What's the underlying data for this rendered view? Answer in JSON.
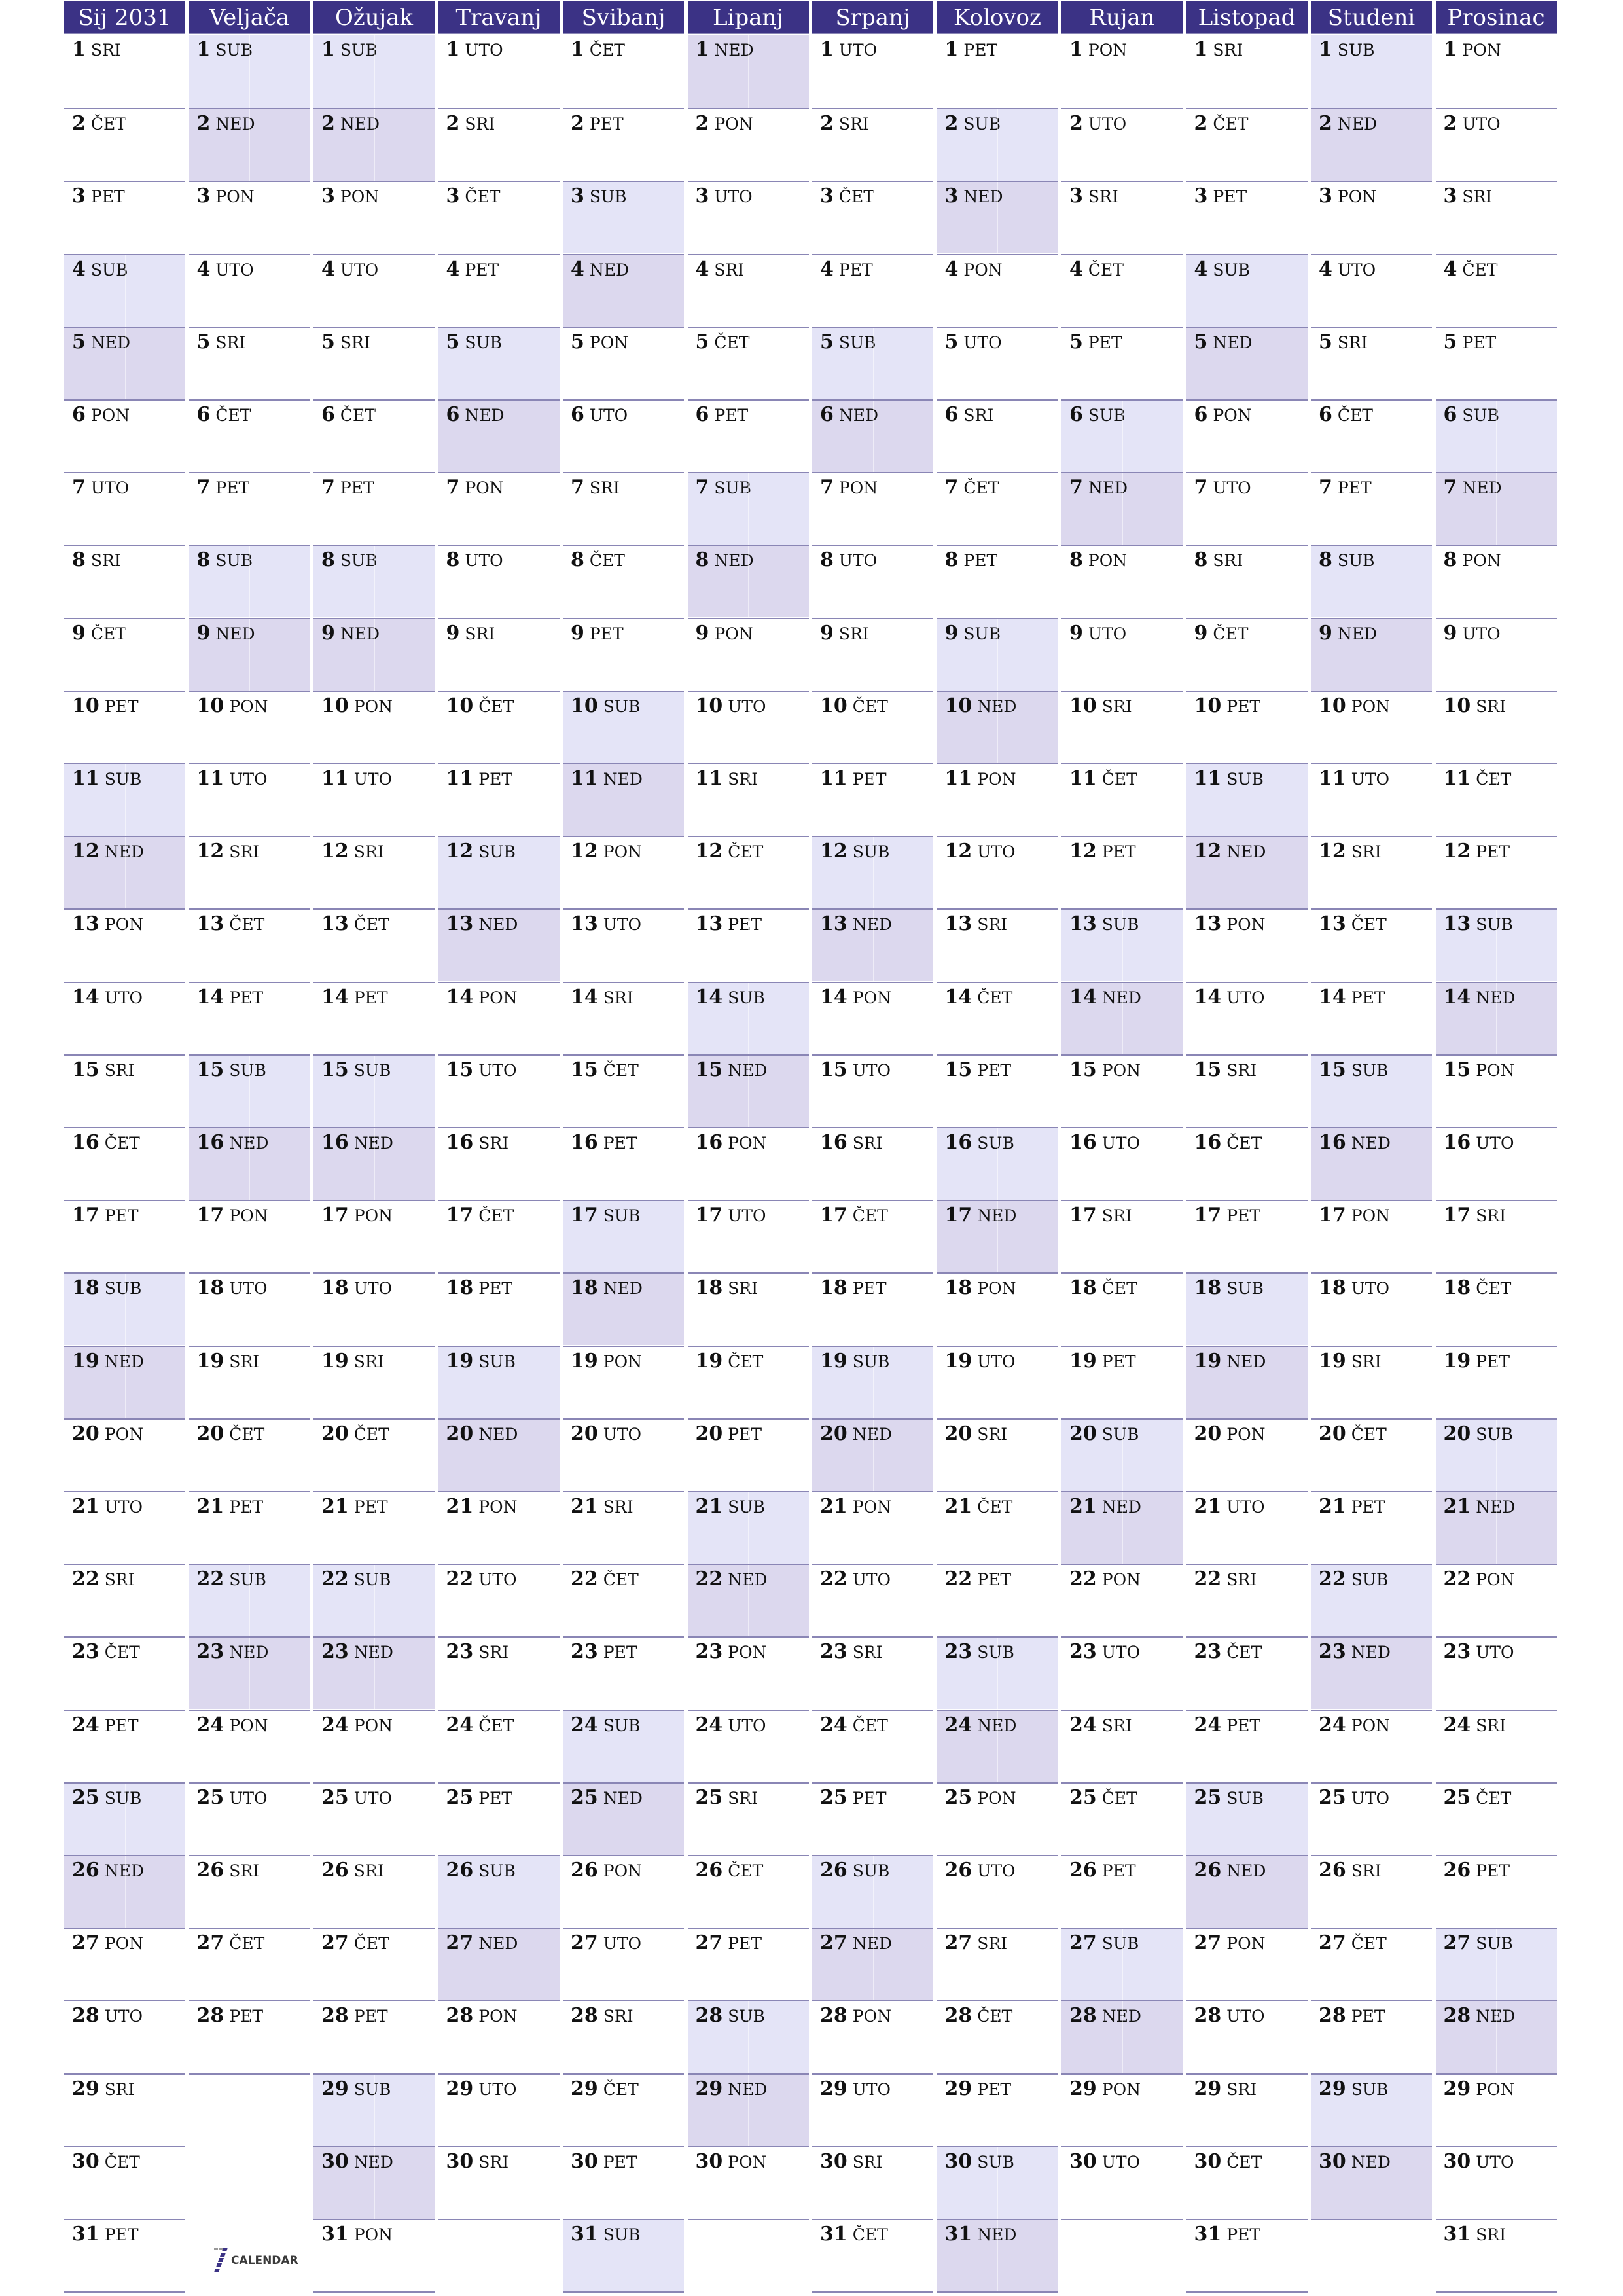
{
  "title": "Sij 2031",
  "year": 2031,
  "colors": {
    "header": "#3b3285",
    "saturday": "#e4e4f7",
    "sunday": "#dcd8ee",
    "rule": "#8a86b5"
  },
  "weekday_codes": [
    "PON",
    "UTO",
    "SRI",
    "ČET",
    "PET",
    "SUB",
    "NED"
  ],
  "months": [
    {
      "label": "Sij 2031",
      "first_weekday": "SRI",
      "days": 31
    },
    {
      "label": "Veljača",
      "first_weekday": "SUB",
      "days": 28
    },
    {
      "label": "Ožujak",
      "first_weekday": "SUB",
      "days": 31
    },
    {
      "label": "Travanj",
      "first_weekday": "UTO",
      "days": 30
    },
    {
      "label": "Svibanj",
      "first_weekday": "ČET",
      "days": 31
    },
    {
      "label": "Lipanj",
      "first_weekday": "NED",
      "days": 30
    },
    {
      "label": "Srpanj",
      "first_weekday": "UTO",
      "days": 31
    },
    {
      "label": "Kolovoz",
      "first_weekday": "PET",
      "days": 31
    },
    {
      "label": "Rujan",
      "first_weekday": "PON",
      "days": 30
    },
    {
      "label": "Listopad",
      "first_weekday": "SRI",
      "days": 31
    },
    {
      "label": "Studeni",
      "first_weekday": "SUB",
      "days": 30
    },
    {
      "label": "Prosinac",
      "first_weekday": "PON",
      "days": 31
    }
  ],
  "logo": {
    "mark": "7",
    "text": "CALENDAR"
  }
}
